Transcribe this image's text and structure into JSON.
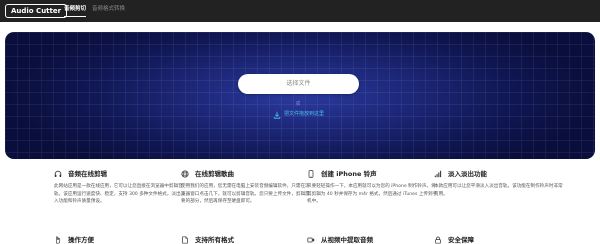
{
  "header": {
    "logo": "Audio Cutter",
    "nav": [
      {
        "label": "音频剪切"
      },
      {
        "label": "音频格式转换"
      }
    ]
  },
  "hero": {
    "choose_file": "选择文件",
    "or": "或",
    "drag_hint": "把文件拖放到这里"
  },
  "features": [
    {
      "icon": "headphones-icon",
      "title": "音频在线剪辑",
      "desc": "此网站应用是一款在线应用，它可以让您直接在浏览器中剪辑音轨。该应用运行速度快、稳定，支持 300 多种文件格式，淡出淡入功能和铃声质量预设。"
    },
    {
      "icon": "globe-icon",
      "title": "在线剪辑歌曲",
      "desc": "使用我们的应用，您无需在电脑上安装音频编辑软件，只需在浏览器窗口点击几下，就可以剪辑音轨。您只要上传文件，剪辑需要的部分，然后再保存至硬盘即可。"
    },
    {
      "icon": "phone-icon",
      "title": "创建 iPhone 铃声",
      "desc": "只要轻轻操作一下，本应用就可以为您的 iPhone 制作铃声。将其剪辑为 40 秒并保存为 m4r 格式，然后通过 iTunes 上传到手机中。"
    },
    {
      "icon": "signal-bars-icon",
      "title": "淡入淡出功能",
      "desc": "本款应用可以让您平滑淡入淡出音轨。该功能在制作铃声时非常有用。"
    },
    {
      "icon": "hand-icon",
      "title": "操作方便",
      "desc": ""
    },
    {
      "icon": "file-icon",
      "title": "支持所有格式",
      "desc": ""
    },
    {
      "icon": "video-icon",
      "title": "从视频中提取音频",
      "desc": ""
    },
    {
      "icon": "lock-icon",
      "title": "安全保障",
      "desc": ""
    }
  ],
  "colors": {
    "topbar": "#222222",
    "hero_dark": "#0a0e3c",
    "hero_light": "#2b3aa0",
    "accent": "#4fc3e8"
  }
}
